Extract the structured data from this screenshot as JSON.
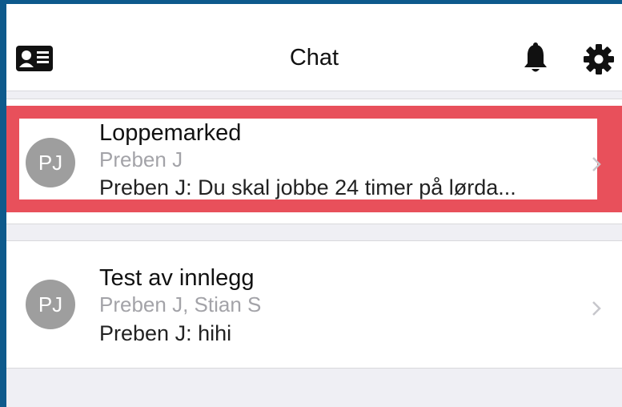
{
  "header": {
    "title": "Chat",
    "left_icon": "contact-card-icon",
    "right_icons": [
      "bell-icon",
      "gear-icon"
    ]
  },
  "chats": [
    {
      "avatar_initials": "PJ",
      "title": "Loppemarked",
      "participants": "Preben J",
      "last_message": "Preben J: Du skal jobbe 24 timer på lørda...",
      "highlighted": true
    },
    {
      "avatar_initials": "PJ",
      "title": "Test av innlegg",
      "participants": "Preben J, Stian S",
      "last_message": "Preben J: hihi",
      "highlighted": false
    }
  ],
  "colors": {
    "highlight_border": "#e8505b",
    "avatar": "#9e9e9e",
    "frame": "#0e5a8c"
  }
}
